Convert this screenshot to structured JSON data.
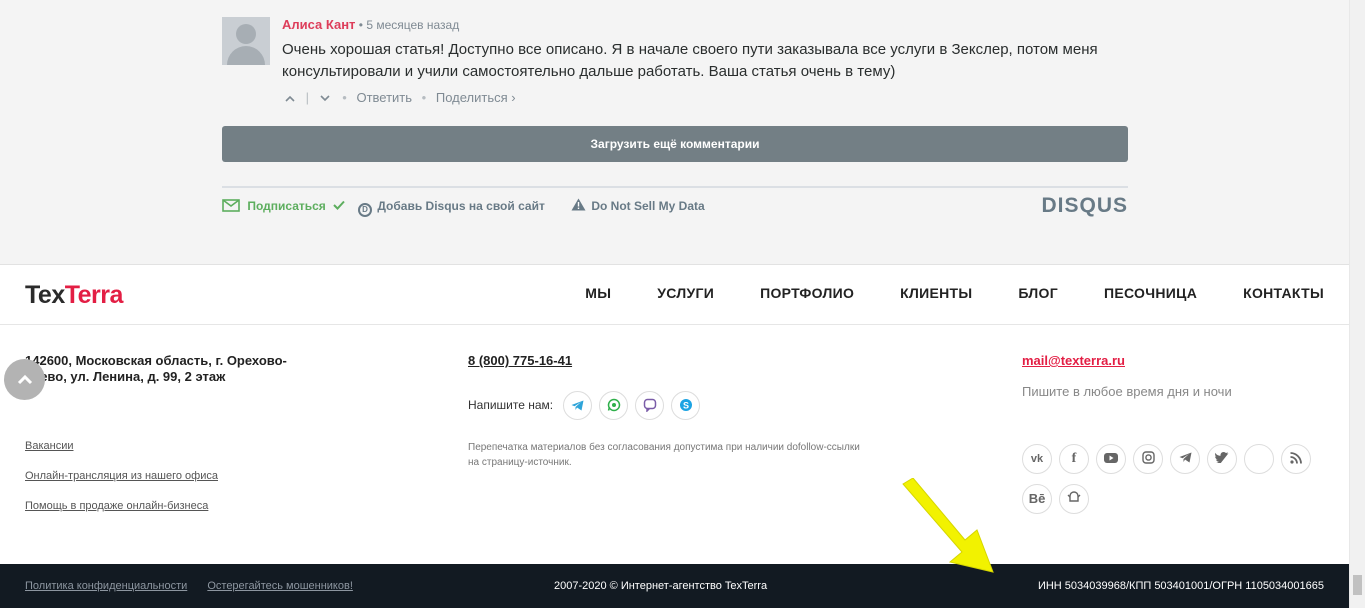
{
  "comment": {
    "author": "Алиса Кант",
    "time_sep": "•",
    "time": "5 месяцев назад",
    "text": "Очень хорошая статья! Доступно все описано. Я в начале своего пути заказывала все услуги в Зекслер, потом меня консультировали и учили самостоятельно дальше работать. Ваша статья очень в тему)",
    "upvote_icon": "chevron-up-icon",
    "downvote_icon": "chevron-down-icon",
    "reply_label": "Ответить",
    "share_label": "Поделиться ›"
  },
  "disqus": {
    "load_more_label": "Загрузить ещё комментарии",
    "subscribe_label": "Подписаться",
    "add_disqus_label": "Добавь Disqus на свой сайт",
    "dns_label": "Do Not Sell My Data",
    "logo_text": "DISQUS"
  },
  "nav": {
    "logo_part1": "Tex",
    "logo_part2": "Terra",
    "items": [
      "МЫ",
      "УСЛУГИ",
      "ПОРТФОЛИО",
      "КЛИЕНТЫ",
      "БЛОГ",
      "ПЕСОЧНИЦА",
      "КОНТАКТЫ"
    ]
  },
  "footer": {
    "address": "142600, Московская область, г. Орехово-Зуево, ул. Ленина, д. 99, 2 этаж",
    "links": [
      "Вакансии",
      "Онлайн-трансляция из нашего офиса",
      "Помощь в продаже онлайн-бизнеса"
    ],
    "phone": "8 (800) 775-16-41",
    "write_us_label": "Напишите нам:",
    "messengers": [
      "telegram-icon",
      "whatsapp-icon",
      "viber-icon",
      "skype-icon"
    ],
    "reprint_note": "Перепечатка материалов без согласования допустима при наличии dofollow-ссылки на страницу-источник.",
    "email": "mail@texterra.ru",
    "email_note": "Пишите в любое время дня и ночи",
    "socials": [
      "vk-icon",
      "facebook-icon",
      "youtube-icon",
      "instagram-icon",
      "telegram-icon",
      "twitter-icon",
      "blank-icon",
      "rss-icon",
      "behance-icon",
      "pikabu-icon"
    ]
  },
  "bottom_bar": {
    "privacy_link": "Политика конфиденциальности",
    "fraud_link": "Остерегайтесь мошенников!",
    "copyright": "2007-2020 © Интернет-агентство TexTerra",
    "legal_ids": "ИНН 5034039968/КПП 503401001/ОГРН 1105034001665"
  },
  "colors": {
    "brand_red": "#e31e44",
    "author_red": "#dd3d5a",
    "load_more_bg": "#737f85",
    "subscribe_green": "#5dae5e",
    "bottom_bar_bg": "#121a22",
    "arrow_yellow": "#f2f200"
  }
}
